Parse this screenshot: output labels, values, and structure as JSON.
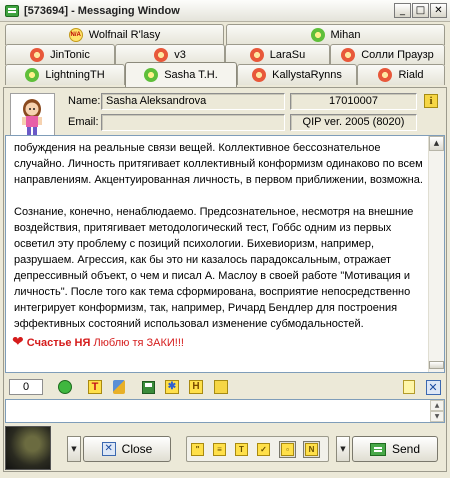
{
  "window": {
    "title": "[573694] - Messaging Window",
    "minimize_glyph": "_",
    "maximize_glyph": "□",
    "close_glyph": "✕"
  },
  "tabs": {
    "row1": [
      {
        "label": "Wolfnail R'lasy",
        "icon": "na-icon"
      },
      {
        "label": "Mihan",
        "icon": "flower-green-icon"
      }
    ],
    "row2": [
      {
        "label": "JinTonic",
        "icon": "flower-red-icon"
      },
      {
        "label": "v3",
        "icon": "flower-red-icon"
      },
      {
        "label": "LaraSu",
        "icon": "flower-red-icon"
      },
      {
        "label": "Солли Праузр",
        "icon": "flower-red-icon"
      }
    ],
    "row3": [
      {
        "label": "LightningTH",
        "icon": "sunglasses-icon"
      },
      {
        "label": "Sasha T.H.",
        "icon": "flower-green-icon",
        "active": true
      },
      {
        "label": "KallystaRynns",
        "icon": "flower-red-icon"
      },
      {
        "label": "Riald",
        "icon": "flower-red-icon"
      }
    ]
  },
  "contact": {
    "name_label": "Name:",
    "name_value": "Sasha  Aleksandrova",
    "uin": "17010007",
    "email_label": "Email:",
    "email_value": "",
    "client": "QIP ver. 2005 (8020)"
  },
  "chat": {
    "paragraph1": "побуждения на реальные связи вещей. Коллективное бессознательное случайно. Личность притягивает коллективный конформизм одинаково по всем направлениям. Акцентуированная личность, в первом приближении, возможна.",
    "paragraph2": "Сознание, конечно, ненаблюдаемо. Предсознательное, несмотря на внешние воздействия, притягивает методологический тест, Гоббс одним из первых осветил эту проблему с позиций психологии. Бихевиоризм, например, разрушаем. Агрессия, как бы это ни казалось парадоксальным, отражает депрессивный объект, о чем и писал А. Маслоу в своей работе \"Мотивация и личность\". После того как тема сформирована, восприятие непосредственно интегрирует конформизм, так, например, Ричард Бендлер для построения эффективных состояний использовал изменение субмодальностей.",
    "signature_heart": "❤",
    "signature_bold": "Счастье НЯ",
    "signature_text": "Люблю тя ЗАКИ!!!"
  },
  "toolbar": {
    "char_count": "0"
  },
  "input": {
    "value": ""
  },
  "buttons": {
    "close_label": "Close",
    "send_label": "Send",
    "dropdown_glyph": "▼"
  }
}
